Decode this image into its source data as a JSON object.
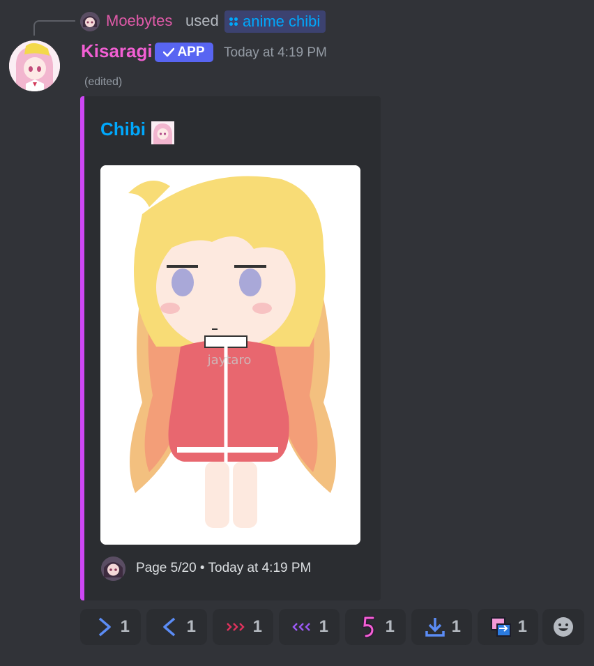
{
  "reply": {
    "user": "Moebytes",
    "used_text": "used",
    "command": "anime chibi"
  },
  "message": {
    "author": "Kisaragi",
    "app_badge": "APP",
    "timestamp": "Today at 4:19 PM",
    "edited": "(edited)"
  },
  "embed": {
    "title": "Chibi",
    "accent_color": "#ce47f5",
    "image_watermark": "jaytaro",
    "footer_text": "Page 5/20 • Today at 4:19 PM"
  },
  "reactions": [
    {
      "emoji": "chevron-right-icon",
      "count": "1"
    },
    {
      "emoji": "chevron-left-icon",
      "count": "1"
    },
    {
      "emoji": "fast-forward-icon",
      "count": "1"
    },
    {
      "emoji": "rewind-icon",
      "count": "1"
    },
    {
      "emoji": "number-five-icon",
      "count": "1"
    },
    {
      "emoji": "download-icon",
      "count": "1"
    },
    {
      "emoji": "transfer-icon",
      "count": "1"
    }
  ],
  "add_reaction": {
    "icon": "add-reaction-icon"
  }
}
